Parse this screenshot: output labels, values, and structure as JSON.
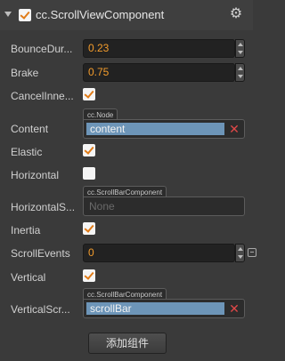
{
  "component": {
    "title": "cc.ScrollViewComponent",
    "enabled": true,
    "settings_icon": "gear-icon",
    "collapse_icon": "triangle-down-icon"
  },
  "properties": {
    "bounce_duration": {
      "label": "BounceDur...",
      "value": "0.23"
    },
    "brake": {
      "label": "Brake",
      "value": "0.75"
    },
    "cancel_inner_events": {
      "label": "CancelInne...",
      "checked": true
    },
    "content": {
      "label": "Content",
      "type_tag": "cc.Node",
      "value": "content",
      "clear_icon": "close-icon"
    },
    "elastic": {
      "label": "Elastic",
      "checked": true
    },
    "horizontal": {
      "label": "Horizontal",
      "checked": false
    },
    "horizontal_scrollbar": {
      "label": "HorizontalS...",
      "type_tag": "cc.ScrollBarComponent",
      "value": "None"
    },
    "inertia": {
      "label": "Inertia",
      "checked": true
    },
    "scroll_events": {
      "label": "ScrollEvents",
      "value": "0",
      "remove_icon": "minus-icon"
    },
    "vertical": {
      "label": "Vertical",
      "checked": true
    },
    "vertical_scrollbar": {
      "label": "VerticalScr...",
      "type_tag": "cc.ScrollBarComponent",
      "value": "scrollBar",
      "clear_icon": "close-icon"
    }
  },
  "add_component_label": "添加组件",
  "colors": {
    "accent_check": "#e07b17",
    "number_text": "#f39c2c",
    "ref_highlight": "#6d95b8",
    "clear_red": "#e04848",
    "panel_bg": "#3a3a3a"
  }
}
